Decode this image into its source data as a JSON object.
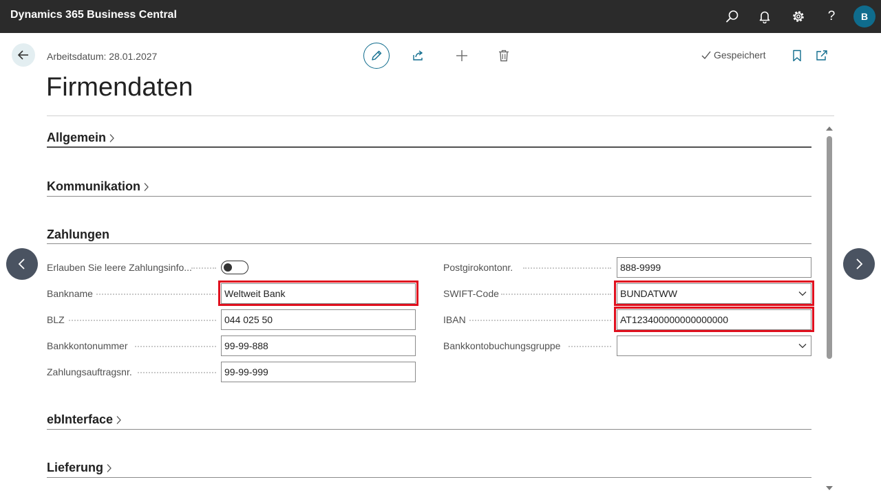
{
  "app": {
    "title": "Dynamics 365 Business Central",
    "user_initial": "B",
    "accent": "#0f6c8d",
    "help_glyph": "?"
  },
  "header": {
    "work_date": "Arbeitsdatum: 28.01.2027",
    "saved_label": "Gespeichert",
    "page_title": "Firmendaten"
  },
  "sections": {
    "allgemein": "Allgemein",
    "kommunikation": "Kommunikation",
    "zahlungen": "Zahlungen",
    "ebinterface": "ebInterface",
    "lieferung": "Lieferung"
  },
  "payments": {
    "allow_blank_label": "Erlauben Sie leere Zahlungsinfo...",
    "allow_blank_value": false,
    "bank_name_label": "Bankname",
    "bank_name_value": "Weltweit Bank",
    "blz_label": "BLZ",
    "blz_value": "044 025 50",
    "bank_account_label": "Bankkontonummer",
    "bank_account_value": "99-99-888",
    "payment_order_label": "Zahlungsauftragsnr.",
    "payment_order_value": "99-99-999",
    "giro_label": "Postgirokontonr.",
    "giro_value": "888-9999",
    "swift_label": "SWIFT-Code",
    "swift_value": "BUNDATWW",
    "iban_label": "IBAN",
    "iban_value": "AT123400000000000000",
    "posting_group_label": "Bankkontobuchungsgruppe",
    "posting_group_value": ""
  },
  "highlight_color": "#e0101e"
}
